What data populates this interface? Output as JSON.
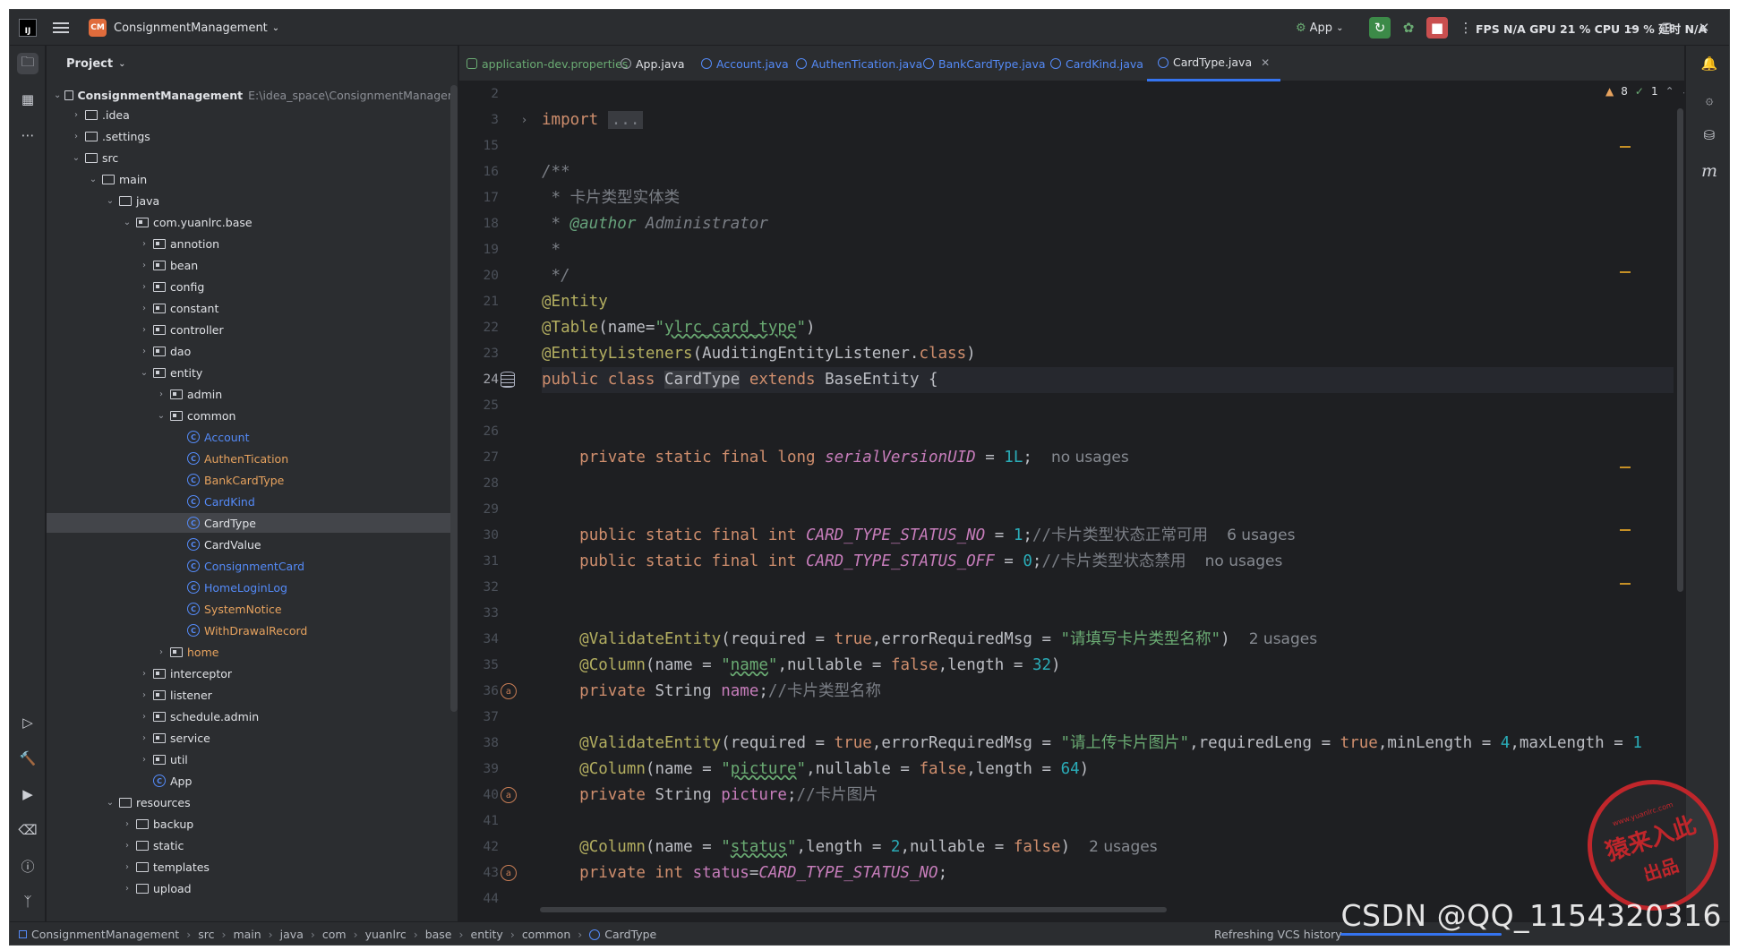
{
  "titlebar": {
    "project_badge": "CM",
    "project_name": "ConsignmentManagement",
    "run_config": "App",
    "metrics": "FPS N/A GPU 21 % CPU 19 % 延时 N/A"
  },
  "project_panel": {
    "title": "Project",
    "root": {
      "name": "ConsignmentManagement",
      "path": "E:\\idea_space\\ConsignmentManagem"
    },
    "tree": [
      {
        "label": ".idea",
        "indent": 1,
        "kind": "folder",
        "expanded": false
      },
      {
        "label": ".settings",
        "indent": 1,
        "kind": "folder",
        "expanded": false
      },
      {
        "label": "src",
        "indent": 1,
        "kind": "folder",
        "expanded": true
      },
      {
        "label": "main",
        "indent": 2,
        "kind": "folder",
        "expanded": true
      },
      {
        "label": "java",
        "indent": 3,
        "kind": "folder",
        "expanded": true
      },
      {
        "label": "com.yuanlrc.base",
        "indent": 4,
        "kind": "package",
        "expanded": true
      },
      {
        "label": "annotion",
        "indent": 5,
        "kind": "package",
        "expanded": false
      },
      {
        "label": "bean",
        "indent": 5,
        "kind": "package",
        "expanded": false
      },
      {
        "label": "config",
        "indent": 5,
        "kind": "package",
        "expanded": false
      },
      {
        "label": "constant",
        "indent": 5,
        "kind": "package",
        "expanded": false
      },
      {
        "label": "controller",
        "indent": 5,
        "kind": "package",
        "expanded": false
      },
      {
        "label": "dao",
        "indent": 5,
        "kind": "package",
        "expanded": false
      },
      {
        "label": "entity",
        "indent": 5,
        "kind": "package",
        "expanded": true
      },
      {
        "label": "admin",
        "indent": 6,
        "kind": "package",
        "expanded": false
      },
      {
        "label": "common",
        "indent": 6,
        "kind": "package",
        "expanded": true
      },
      {
        "label": "Account",
        "indent": 7,
        "kind": "class",
        "color": "blue"
      },
      {
        "label": "AuthenTication",
        "indent": 7,
        "kind": "class",
        "color": "orange"
      },
      {
        "label": "BankCardType",
        "indent": 7,
        "kind": "class",
        "color": "orange"
      },
      {
        "label": "CardKind",
        "indent": 7,
        "kind": "class",
        "color": "blue"
      },
      {
        "label": "CardType",
        "indent": 7,
        "kind": "class",
        "color": "white",
        "selected": true
      },
      {
        "label": "CardValue",
        "indent": 7,
        "kind": "class",
        "color": "white"
      },
      {
        "label": "ConsignmentCard",
        "indent": 7,
        "kind": "class",
        "color": "blue"
      },
      {
        "label": "HomeLoginLog",
        "indent": 7,
        "kind": "class",
        "color": "blue"
      },
      {
        "label": "SystemNotice",
        "indent": 7,
        "kind": "class",
        "color": "orange"
      },
      {
        "label": "WithDrawalRecord",
        "indent": 7,
        "kind": "class",
        "color": "orange"
      },
      {
        "label": "home",
        "indent": 6,
        "kind": "package",
        "expanded": false,
        "color": "orange"
      },
      {
        "label": "interceptor",
        "indent": 5,
        "kind": "package",
        "expanded": false
      },
      {
        "label": "listener",
        "indent": 5,
        "kind": "package",
        "expanded": false
      },
      {
        "label": "schedule.admin",
        "indent": 5,
        "kind": "package",
        "expanded": false
      },
      {
        "label": "service",
        "indent": 5,
        "kind": "package",
        "expanded": false
      },
      {
        "label": "util",
        "indent": 5,
        "kind": "package",
        "expanded": false
      },
      {
        "label": "App",
        "indent": 5,
        "kind": "app-class"
      },
      {
        "label": "resources",
        "indent": 3,
        "kind": "folder",
        "expanded": true
      },
      {
        "label": "backup",
        "indent": 4,
        "kind": "folder",
        "expanded": false
      },
      {
        "label": "static",
        "indent": 4,
        "kind": "folder",
        "expanded": false
      },
      {
        "label": "templates",
        "indent": 4,
        "kind": "folder",
        "expanded": false
      },
      {
        "label": "upload",
        "indent": 4,
        "kind": "folder",
        "expanded": false
      }
    ]
  },
  "tabs": [
    {
      "label": "application-dev.properties",
      "kind": "props"
    },
    {
      "label": "App.java",
      "kind": "app"
    },
    {
      "label": "Account.java",
      "kind": "class"
    },
    {
      "label": "AuthenTication.java",
      "kind": "class"
    },
    {
      "label": "BankCardType.java",
      "kind": "class"
    },
    {
      "label": "CardKind.java",
      "kind": "class"
    },
    {
      "label": "CardType.java",
      "kind": "class",
      "active": true
    }
  ],
  "inspection": {
    "warnings": "8",
    "weak": "1"
  },
  "gutter_lines": [
    "2",
    "3",
    "15",
    "16",
    "17",
    "18",
    "19",
    "20",
    "21",
    "22",
    "23",
    "24",
    "25",
    "26",
    "27",
    "28",
    "29",
    "30",
    "31",
    "32",
    "33",
    "34",
    "35",
    "36",
    "37",
    "38",
    "39",
    "40",
    "41",
    "42",
    "43",
    "44"
  ],
  "status": {
    "breadcrumbs": [
      "ConsignmentManagement",
      "src",
      "main",
      "java",
      "com",
      "yuanlrc",
      "base",
      "entity",
      "common",
      "CardType"
    ],
    "task": "Refreshing VCS history",
    "watermark": "CSDN @QQ_1154320316"
  },
  "stamp": {
    "line1": "猿来入此",
    "line2": "出品",
    "url": "www.yuanlrc.com"
  },
  "colors": {
    "accent": "#3574f0",
    "keyword": "#cf8e6d",
    "string": "#6aab73",
    "annotation": "#b3ae60",
    "stamp": "#c0262b"
  }
}
